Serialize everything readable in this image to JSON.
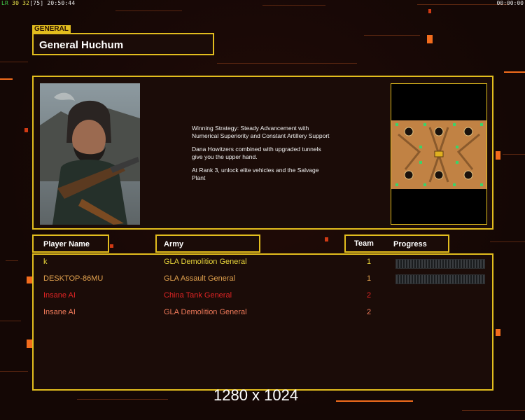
{
  "hud": {
    "fps_label": "LR",
    "fps_a": "30",
    "fps_b": "32",
    "fps_c": "[75]",
    "clock": "20:50:44",
    "timer": "00:00:00"
  },
  "general": {
    "tag": "GENERAL",
    "name": "General Huchum"
  },
  "strategy": [
    "Winning Strategy: Steady Advancement with\n Numerical Superiority and Constant Artillery Support",
    "Dana Howitzers combined with upgraded tunnels\n give you the upper hand.",
    "At Rank 3, unlock elite vehicles and the Salvage\n Plant"
  ],
  "headers": {
    "player_name": "Player Name",
    "army": "Army",
    "team": "Team",
    "progress": "Progress"
  },
  "players": [
    {
      "name": "k",
      "army": "GLA Demolition General",
      "team": "1",
      "color": "#e8d53a",
      "progress_bar": true
    },
    {
      "name": "DESKTOP-86MU",
      "army": "GLA Assault General",
      "team": "1",
      "color": "#e2a24e",
      "progress_bar": true
    },
    {
      "name": "Insane AI",
      "army": "China Tank General",
      "team": "2",
      "color": "#e02424",
      "progress_bar": false
    },
    {
      "name": "Insane AI",
      "army": "GLA Demolition General",
      "team": "2",
      "color": "#f07a5a",
      "progress_bar": false
    }
  ],
  "resolution_text": "1280 x 1024",
  "colors": {
    "frame": "#e2bd1e",
    "background": "#140705",
    "accent_orange": "#f26c1d"
  }
}
